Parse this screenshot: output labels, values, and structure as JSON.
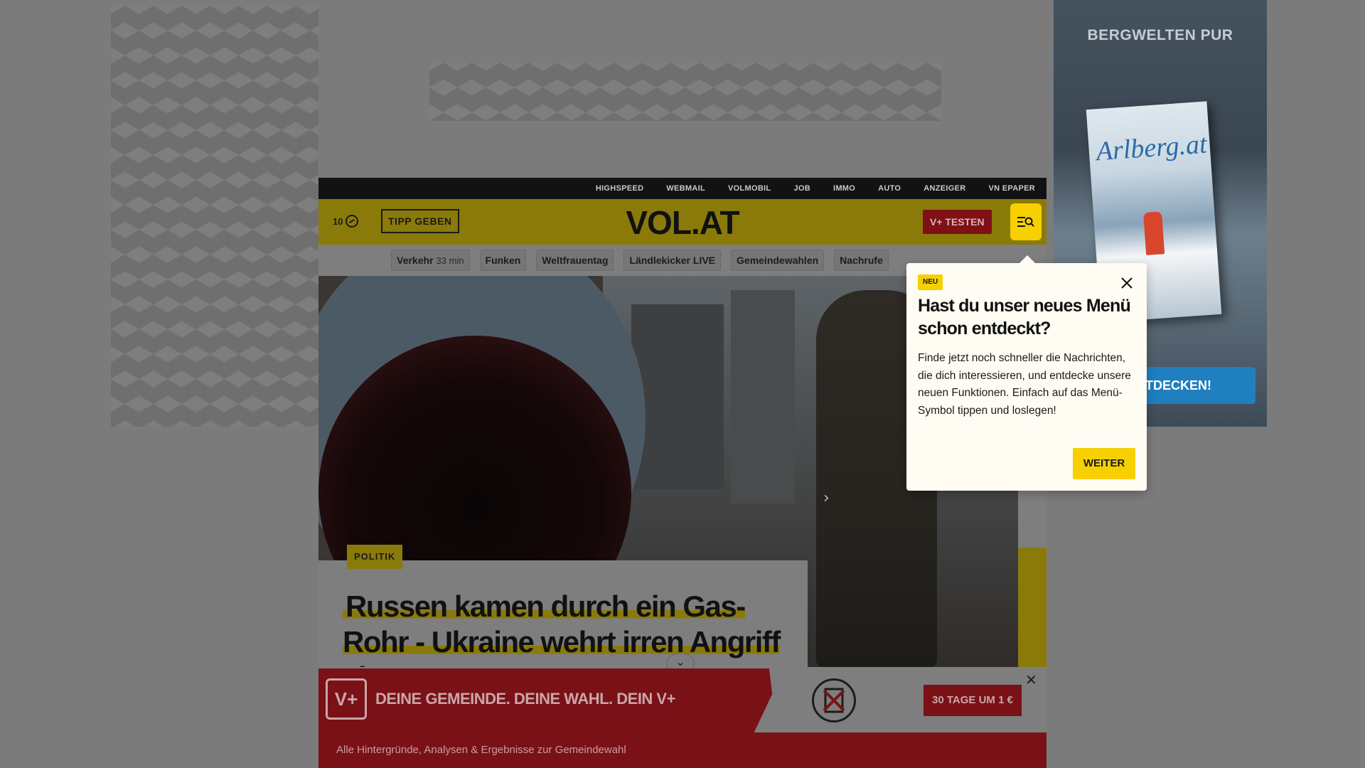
{
  "top_links": [
    "HIGHSPEED",
    "WEBMAIL",
    "VOLMOBIL",
    "JOB",
    "IMMO",
    "AUTO",
    "ANZEIGER",
    "VN EPAPER"
  ],
  "header": {
    "weather_temp": "10",
    "tipp_label": "TIPP GEBEN",
    "logo": "VOL.AT",
    "vplus_label": "V+ TESTEN"
  },
  "topics": [
    {
      "label": "Verkehr",
      "sub": "33 min"
    },
    {
      "label": "Funken",
      "sub": ""
    },
    {
      "label": "Weltfrauentag",
      "sub": ""
    },
    {
      "label": "Ländlekicker LIVE",
      "sub": ""
    },
    {
      "label": "Gemeindewahlen",
      "sub": ""
    },
    {
      "label": "Nachrufe",
      "sub": ""
    }
  ],
  "article": {
    "category": "POLITIK",
    "headline": "Russen kamen durch ein Gas-Rohr - Ukraine wehrt irren Angriff ab"
  },
  "right_ad": {
    "title": "BERGWELTEN PUR",
    "magazine_title": "Arlberg.at",
    "cta": "ENTDECKEN!"
  },
  "popover": {
    "badge": "NEU",
    "title": "Hast du unser neues Menü schon entdeckt?",
    "text": "Finde jetzt noch schneller die Nachrichten, die dich interessieren, und entdecke unsere neuen Funktionen. Einfach auf das Menü-Symbol tippen und loslegen!",
    "button": "WEITER"
  },
  "promo": {
    "logo": "V+",
    "headline": "DEINE GEMEINDE. DEINE WAHL. DEIN V+",
    "cta": "30 TAGE UM 1 €",
    "subtitle": "Alle Hintergründe, Analysen & Ergebnisse zur Gemeindewahl"
  },
  "colors": {
    "brand_yellow": "#f6d000",
    "dimmed_yellow": "#8a7a0a",
    "promo_red": "#7a1117",
    "overlay_gray": "#7b7b7b"
  }
}
